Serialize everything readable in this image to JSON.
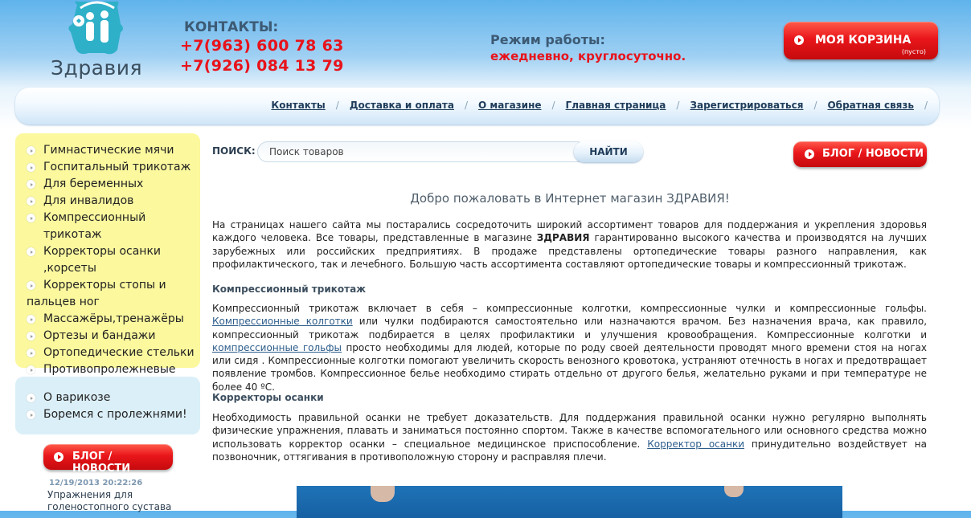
{
  "header": {
    "logo_text": "Здравия",
    "contacts_title": "КОНТАКТЫ:",
    "phones": [
      "+7(963) 600 78 63",
      "+7(926) 084 13 79"
    ],
    "hours_title": "Режим работы:",
    "hours_value": "ежедневно, круглосуточно.",
    "cart_label": "МОЯ КОРЗИНА",
    "cart_status": "(пусто)"
  },
  "nav": {
    "items": [
      "Контакты",
      "Доставка и оплата",
      "О магазине",
      "Главная страница",
      "Зарегистрироваться",
      "Обратная связь"
    ]
  },
  "sidebar": {
    "categories": [
      "Гимнастические мячи",
      "Госпитальный трикотаж",
      "Для беременных",
      "Для инвалидов",
      "Компрессионный трикотаж",
      "Корректоры осанки ,корсеты",
      "Корректоры стопы и пальцев ног",
      "Массажёры,тренажёры",
      "Ортезы и бандажи",
      "Ортопедические стельки",
      "Противопролежневые системы"
    ],
    "info_links": [
      "О варикозе",
      "Боремся с пролежнями!"
    ],
    "blog_label": "БЛОГ / НОВОСТИ",
    "news": {
      "date": "12/19/2013 20:22:26",
      "title": "Упражнения для голеностопного сустава"
    }
  },
  "search": {
    "label": "ПОИСК:",
    "placeholder": "Поиск товаров",
    "button_label": "НАЙТИ"
  },
  "main": {
    "blog_label": "БЛОГ / НОВОСТИ",
    "welcome": "Добро пожаловать в Интернет магазин ЗДРАВИЯ!",
    "intro": {
      "t1": "На страницах нашего сайта мы постарались сосредоточить широкий ассортимент товаров для поддержания и укрепления здоровья каждого человека. Все товары, представленные в магазине ",
      "brand": "ЗДРАВИЯ",
      "t2": " гарантированно высокого качества и производятся на лучших зарубежных или российских предприятиях. В продаже представлены ортопедические товары разного направления, как профилактического, так и лечебного. Большую часть ассортимента составляют ортопедические товары и компрессионный трикотаж."
    },
    "section1": {
      "heading": "Компрессионный трикотаж",
      "t1": "Компрессионный трикотаж включает в себя – компрессионные колготки, компрессионные чулки и компрессионные гольфы. ",
      "link1": "Компрессионные колготки",
      "t2": " или чулки подбираются самостоятельно или назначаются врачом. Без назначения врача, как правило, компрессионный трикотаж подбирается в целях профилактики и улучшения кровообращения. Компрессионные колготки и ",
      "link2": "компрессионные гольфы",
      "t3": " просто необходимы для людей, которые по роду своей деятельности проводят много времени стоя на ногах или сидя . Компрессионные колготки помогают увеличить скорость венозного кровотока, устраняют отечность в ногах и предотвращает появление тромбов. Компрессионное белье необходимо стирать отдельно от другого белья, желательно руками и при температуре не более 40 ºС."
    },
    "section2": {
      "heading": "Корректоры осанки",
      "t1": "Необходимость правильной осанки не требует доказательств. Для поддержания правильной осанки нужно регулярно выполнять физические упражнения, плавать и заниматься постоянно спортом. Также в качестве вспомогательного или основного средства можно использовать корректор осанки – специальное медицинское приспособление. ",
      "link1": "Корректор осанки",
      "t2": " принудительно воздействует на позвоночник, оттягивания в противоположную сторону и расправляя плечи."
    }
  }
}
